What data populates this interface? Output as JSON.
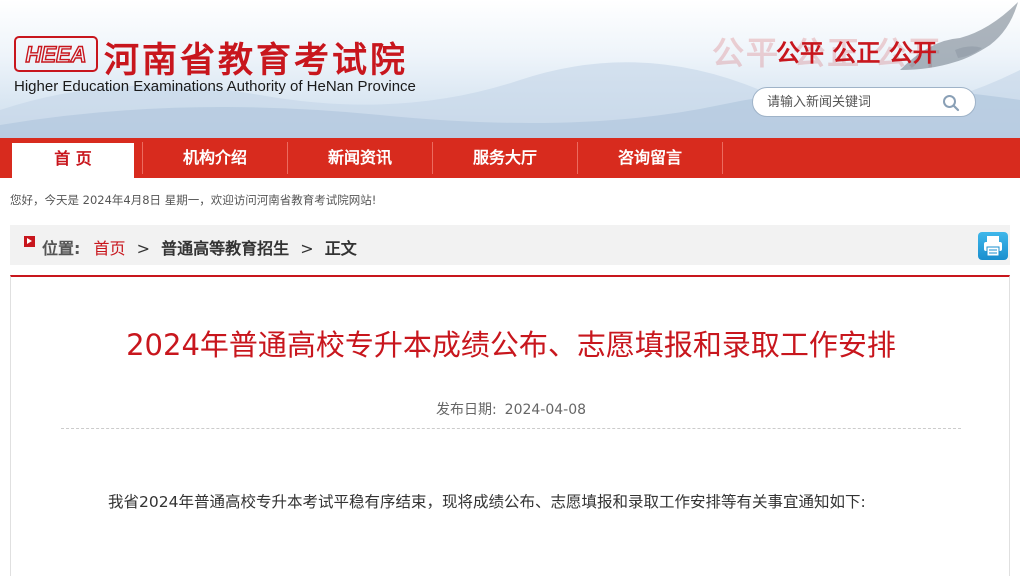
{
  "header": {
    "logo_text": "HEEA",
    "site_title": "河南省教育考试院",
    "site_subtitle": "Higher Education Examinations Authority of HeNan Province",
    "slogan_ghost": "公平 公正 公开",
    "slogan": "公平 公正 公开",
    "search": {
      "placeholder": "请输入新闻关键词",
      "icon": "search-icon"
    }
  },
  "nav": {
    "items": [
      {
        "label": "首 页",
        "active": true
      },
      {
        "label": "机构介绍"
      },
      {
        "label": "新闻资讯"
      },
      {
        "label": "服务大厅"
      },
      {
        "label": "咨询留言"
      }
    ]
  },
  "welcome_text": "您好，今天是 2024年4月8日 星期一，欢迎访问河南省教育考试院网站!",
  "breadcrumb": {
    "label": "位置:",
    "home": "首页",
    "section": "普通高等教育招生",
    "current": "正文",
    "separator": ">",
    "print_icon": "printer-icon"
  },
  "article": {
    "title": "2024年普通高校专升本成绩公布、志愿填报和录取工作安排",
    "date_label": "发布日期:",
    "date": "2024-04-08",
    "body": "我省2024年普通高校专升本考试平稳有序结束，现将成绩公布、志愿填报和录取工作安排等有关事宜通知如下:"
  },
  "colors": {
    "brand_red": "#c8161d",
    "nav_red": "#d82b1e",
    "print_blue": "#1a8fcf"
  }
}
